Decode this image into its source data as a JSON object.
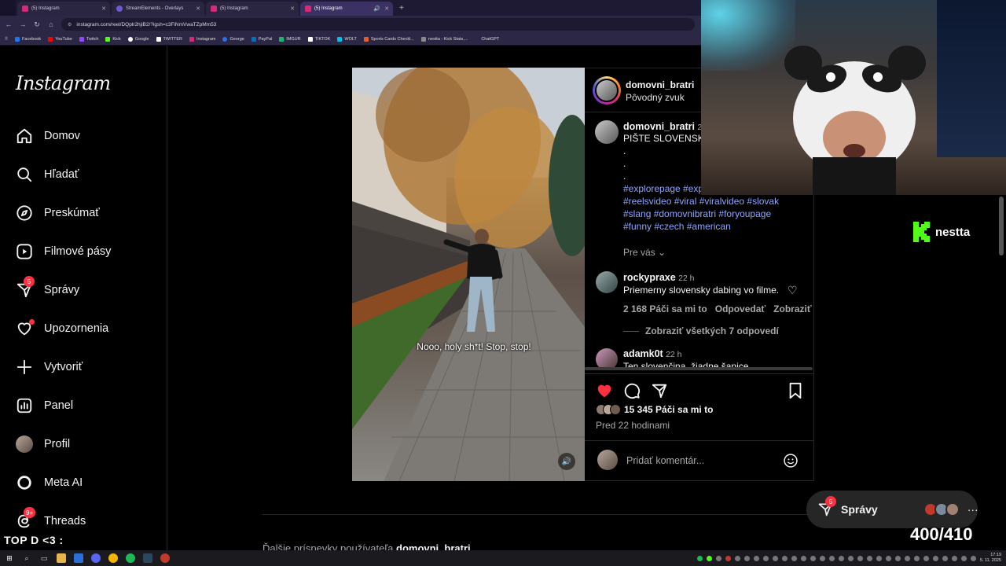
{
  "browser": {
    "tabs": [
      {
        "label": "(5) Instagram",
        "active": false
      },
      {
        "label": "StreamElements - Overlays",
        "active": false
      },
      {
        "label": "(5) Instagram",
        "active": false
      },
      {
        "label": "(5) Instagram",
        "active": true
      }
    ],
    "url": "instagram.com/reel/DQplr2hjiB2/?igsh=c3FiNmVwaTZpMm53",
    "bookmarks": [
      {
        "label": "Facebook",
        "color": "#1877f2"
      },
      {
        "label": "YouTube",
        "color": "#ff0000"
      },
      {
        "label": "Twitch",
        "color": "#9146ff"
      },
      {
        "label": "Kick",
        "color": "#53fc18"
      },
      {
        "label": "Google",
        "color": "#ffffff"
      },
      {
        "label": "TWITTER",
        "color": "#ffffff"
      },
      {
        "label": "Instagram",
        "color": "#d62976"
      },
      {
        "label": "George",
        "color": "#2870ed"
      },
      {
        "label": "PayPal",
        "color": "#0070ba"
      },
      {
        "label": "IMGUR",
        "color": "#1bb76e"
      },
      {
        "label": "TIKTOK",
        "color": "#ffffff"
      },
      {
        "label": "WOLT",
        "color": "#00c2e8"
      },
      {
        "label": "Sports Cards Checkl...",
        "color": "#e65c2f"
      },
      {
        "label": "nestta - Kick Stats,...",
        "color": "#888888"
      },
      {
        "label": "ChatGPT",
        "color": "#10a37f"
      }
    ]
  },
  "instagram": {
    "logo": "Instagram",
    "nav": [
      {
        "label": "Domov",
        "icon": "home-icon"
      },
      {
        "label": "Hľadať",
        "icon": "search-icon"
      },
      {
        "label": "Preskúmať",
        "icon": "compass-icon"
      },
      {
        "label": "Filmové pásy",
        "icon": "reels-icon"
      },
      {
        "label": "Správy",
        "icon": "messenger-icon",
        "badge": "5"
      },
      {
        "label": "Upozornenia",
        "icon": "heart-icon"
      },
      {
        "label": "Vytvoriť",
        "icon": "plus-icon"
      },
      {
        "label": "Panel",
        "icon": "dashboard-icon"
      },
      {
        "label": "Profil",
        "icon": "profile-avatar"
      },
      {
        "label": "Meta AI",
        "icon": "meta-ai-icon"
      },
      {
        "label": "Threads",
        "icon": "threads-icon",
        "badge": "9+"
      }
    ],
    "post": {
      "author": "domovni_bratri",
      "audio": "Pôvodný zvuk",
      "video_caption": "Nooo, holy sh*t! Stop, stop!",
      "caption_author": "domovni_bratri",
      "caption_time": "2",
      "caption_text": "PIŠTE SLOVENSKÉ",
      "dots": ".",
      "hashtags_line1": "#explorepage #exp",
      "hashtags_line2": "#reelsvideo #viral #viralvideo #slovak",
      "hashtags_line3": "#slang #domovnibratri #foryoupage",
      "hashtags_line4": "#funny #czech #american",
      "translate": "Pre vás",
      "comments": [
        {
          "user": "rockypraxe",
          "time": "22 h",
          "text": "Priemerny slovensky dabing vo filme.",
          "likes": "2 168 Páči sa mi to",
          "reply": "Odpovedať",
          "translate": "Zobraziť preklad"
        },
        {
          "user": "adamk0t",
          "time": "22 h",
          "text": "Ten slovenčina, žiadne šanice"
        }
      ],
      "view_replies": "Zobraziť všetkých 7 odpovedí",
      "likes": "15 345 Páči sa mi to",
      "posted": "Pred 22 hodinami",
      "comment_placeholder": "Pridať komentár..."
    },
    "more_posts_prefix": "Ďalšie príspevky používateľa",
    "more_posts_user": "domovni_bratri",
    "dm_pill": {
      "label": "Správy",
      "badge": "5"
    }
  },
  "overlay": {
    "streamer": "nestta",
    "chat_banner": "TOP D <3 :",
    "counter": "400/410"
  },
  "taskbar": {
    "time": "17:19",
    "date": "5. 11. 2025"
  },
  "colors": {
    "ig_bg": "#000000",
    "like_red": "#ff3040",
    "hashtag_blue": "#8ea6ff",
    "kick_green": "#53fc18"
  }
}
